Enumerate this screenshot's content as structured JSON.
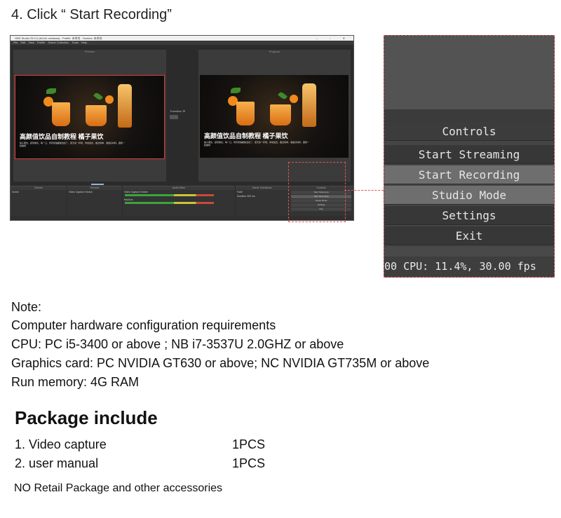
{
  "step_title": "4. Click “ Start Recording”",
  "obs": {
    "window_title": "OBS Studio 25.0.4 (64-bit, windows) - Profile: 未命名 - Scenes: 未命名",
    "window_controls": "– ▫ ✕",
    "menu": [
      "File",
      "Edit",
      "View",
      "Profile",
      "Scene Collection",
      "Tools",
      "Help"
    ],
    "preview_label": "Preview",
    "program_label": "Program",
    "video_title": "高颜值饮品自制教程  橘子果饮",
    "video_subtitle": "橘子果饮，颜值爆表，喝一口，所有烦恼都被治愈了，夏天来一杯吧，非常适合，做法简单，准备好材料，跟我一起做吧",
    "transition_label": "Transition",
    "docks": {
      "scenes": "Scenes",
      "sources": "Sources",
      "mixer": "Audio Mixer",
      "transitions": "Scene Transitions",
      "controls": "Controls"
    },
    "scene_item": "Scene",
    "source_item": "Video Capture Device",
    "mixer_tracks": [
      "Video Capture Device",
      "Mic/Aux"
    ],
    "transition_select": "Fade",
    "duration_label": "Duration",
    "duration_value": "300 ms",
    "mini_controls": [
      "Start Streaming",
      "Start Recording",
      "Studio Mode",
      "Settings",
      "Exit"
    ]
  },
  "zoom_panel": {
    "header": "Controls",
    "buttons": [
      "Start Streaming",
      "Start Recording",
      "Studio Mode",
      "Settings",
      "Exit"
    ],
    "highlighted": [
      "Start Recording",
      "Studio Mode"
    ],
    "status": "00   CPU: 11.4%, 30.00 fps"
  },
  "note": {
    "heading": "Note:",
    "lines": [
      "Computer hardware configuration requirements",
      "CPU: PC  i5-3400 or above ;  NB  i7-3537U 2.0GHZ or above",
      "Graphics card: PC NVIDIA GT630 or above;  NC  NVIDIA  GT735M or above",
      "Run memory: 4G RAM"
    ]
  },
  "package": {
    "title": "Package include",
    "items": [
      {
        "name": "1. Video capture",
        "qty": "1PCS"
      },
      {
        "name": "2. user manual",
        "qty": "1PCS"
      }
    ],
    "footer": "NO Retail Package and other accessories"
  },
  "colors": {
    "highlight_dashed": "#dd5555",
    "panel_bg": "#454545",
    "button_highlight": "#6e6e6e"
  }
}
